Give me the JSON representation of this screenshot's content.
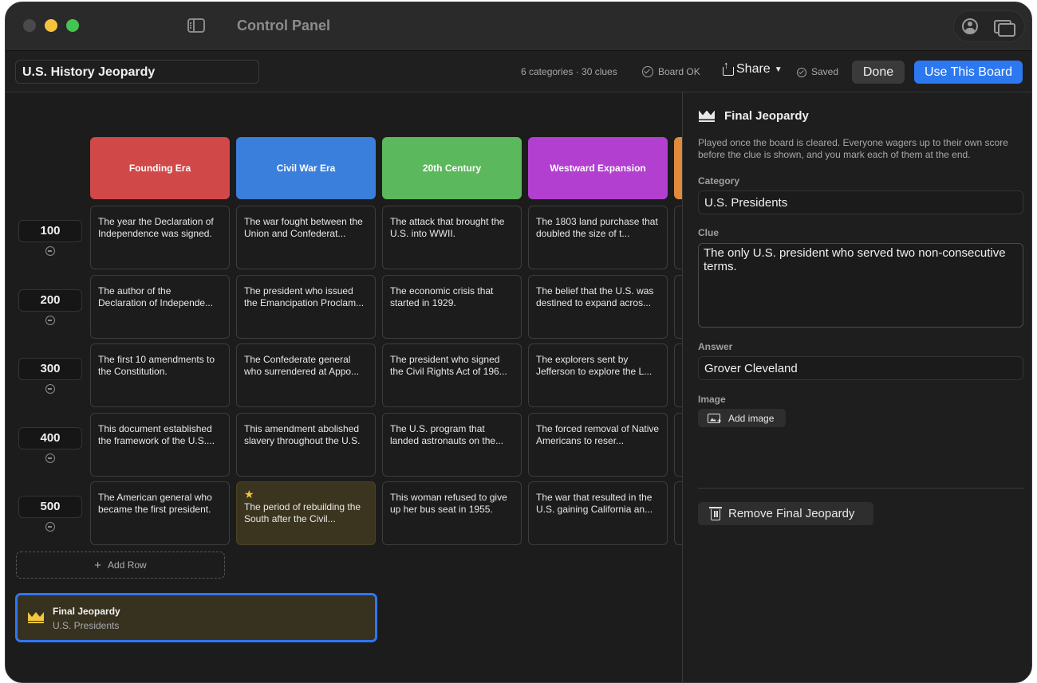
{
  "window": {
    "title": "Control Panel"
  },
  "toolbar": {
    "board_name": "U.S. History Jeopardy",
    "counts": "6 categories · 30 clues",
    "board_status": "Board OK",
    "share_label": "Share",
    "saved_label": "Saved",
    "done_label": "Done",
    "use_label": "Use This Board"
  },
  "board": {
    "categories": [
      {
        "name": "Founding Era",
        "color": "#d04848"
      },
      {
        "name": "Civil War Era",
        "color": "#3a7fdb"
      },
      {
        "name": "20th Century",
        "color": "#5cb85c"
      },
      {
        "name": "Westward Expansion",
        "color": "#b23fd0"
      },
      {
        "name": "",
        "color": "#e08a3a"
      }
    ],
    "rows": [
      {
        "points": "100",
        "clues": [
          "The year the Declaration of Independence was signed.",
          "The war fought between the Union and Confederat...",
          "The attack that brought the U.S. into WWII.",
          "The 1803 land purchase that doubled the size of t...",
          ""
        ]
      },
      {
        "points": "200",
        "clues": [
          "The author of the Declaration of Independe...",
          "The president who issued the Emancipation Proclam...",
          "The economic crisis that started in 1929.",
          "The belief that the U.S. was destined to expand acros...",
          ""
        ]
      },
      {
        "points": "300",
        "clues": [
          "The first 10 amendments to the Constitution.",
          "The Confederate general who surrendered at Appo...",
          "The president who signed the Civil Rights Act of 196...",
          "The explorers sent by Jefferson to explore the L...",
          ""
        ]
      },
      {
        "points": "400",
        "clues": [
          "This document established the framework of the U.S....",
          "This amendment abolished slavery throughout the U.S.",
          "The U.S. program that landed astronauts on the...",
          "The forced removal of Native Americans to reser...",
          ""
        ]
      },
      {
        "points": "500",
        "clues": [
          "The American general who became the first president.",
          "The period of rebuilding the South after the Civil...",
          "This woman refused to give up her bus seat in 1955.",
          "The war that resulted in the U.S. gaining California an...",
          ""
        ]
      }
    ],
    "add_row_label": "Add Row",
    "final_card": {
      "title": "Final Jeopardy",
      "subtitle": "U.S. Presidents"
    }
  },
  "panel": {
    "title": "Final Jeopardy",
    "description": "Played once the board is cleared. Everyone wagers up to their own score before the clue is shown, and you mark each of them at the end.",
    "category_label": "Category",
    "category_value": "U.S. Presidents",
    "clue_label": "Clue",
    "clue_value": "The only U.S. president who served two non-consecutive terms.",
    "answer_label": "Answer",
    "answer_value": "Grover Cleveland",
    "image_label": "Image",
    "add_image_label": "Add image",
    "remove_label": "Remove Final Jeopardy"
  }
}
